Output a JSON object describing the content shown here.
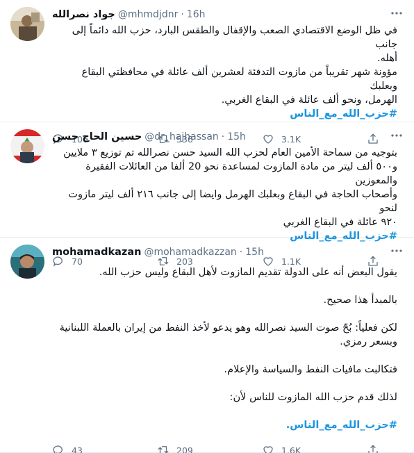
{
  "tweets": [
    {
      "name": "جواد نصرالله",
      "handle": "@mhmdjdnr",
      "time": "16h",
      "lines": [
        "في ظل الوضع الاقتصادي الصعب والإقفال والطقس البارد، حزب الله دائماً إلى جانب",
        "أهله.",
        "مؤونة شهر تقريباً من مازوت التدفئة لعشرين ألف عائلة في محافظتي البقاع وبعلبك",
        "الهرمل، ونحو ألف عائلة في البقاع الغربي."
      ],
      "hashtag": "#حزب_الله_مع_الناس",
      "replies": "106",
      "retweets": "536",
      "likes": "3.1K"
    },
    {
      "name": "حسين الحاج حسن",
      "handle": "@dr_hajhassan",
      "time": "15h",
      "lines": [
        "بتوجيه من سماحة الأمين العام لحزب الله السيد حسن نصرالله تم توزيع ٣ ملايين",
        "و٥٠٠ ألف ليتر من مادة المازوت لمساعدة نحو 20 ألفا من العائلات الفقيرة والمعوزين",
        "وأصحاب الحاجة في البقاع وبعلبك الهرمل وايضا إلى جانب ٢١٦ ألف ليتر مازوت لنحو",
        "٩٢٠ عائلة في البقاع الغربي"
      ],
      "hashtag": "#حزب_الله_مع_الناس",
      "replies": "70",
      "retweets": "203",
      "likes": "1.1K"
    },
    {
      "name": "mohamadkazan",
      "handle": "@mohamadkazzan",
      "time": "15h",
      "paragraphs": [
        [
          "يقول البعض أنه على الدولة تقديم المازوت لأهل البقاع وليس حزب الله."
        ],
        [
          "بالمبدأ هذا صحيح."
        ],
        [
          "لكن فعلياً: بُحّ صوت السيد نصرالله وهو يدعو لأخذ النفط من إيران بالعملة اللبنانية",
          "وبسعر رمزي."
        ],
        [
          "فتكالبت مافيات النفط والسياسة والإعلام."
        ],
        [
          "لذلك قدم حزب الله المازوت للناس لأن:"
        ]
      ],
      "hashtag": "#حزب_الله_مع_الناس.",
      "replies": "43",
      "retweets": "209",
      "likes": "1.6K"
    }
  ],
  "icons": {
    "reply": "reply-icon",
    "retweet": "retweet-icon",
    "like": "heart-icon",
    "share": "share-icon",
    "more": "more-icon"
  },
  "colors": {
    "hashtag": "#1b95e0",
    "muted": "#5b7083",
    "divider": "#e6ecf0"
  }
}
